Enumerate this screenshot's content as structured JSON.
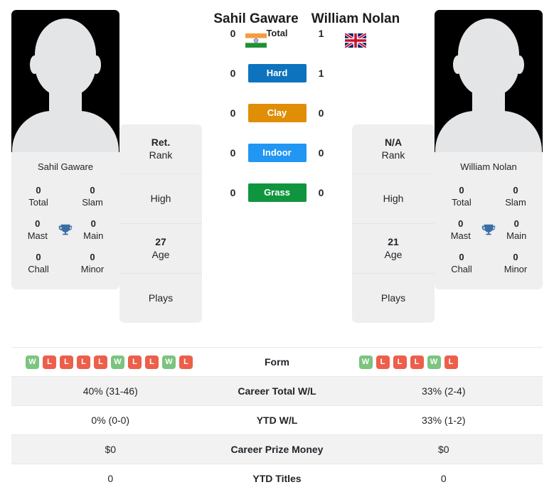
{
  "players": {
    "left": {
      "name": "Sahil Gaware",
      "photo_name": "Sahil Gaware",
      "country": "india",
      "rank_value": "Ret.",
      "rank_label": "Rank",
      "high_label": "High",
      "age_value": "27",
      "age_label": "Age",
      "plays_label": "Plays",
      "titles": [
        {
          "num": "0",
          "label": "Total"
        },
        {
          "num": "0",
          "label": "Slam"
        },
        {
          "num": "0",
          "label": "Mast"
        },
        {
          "num": "0",
          "label": "Main"
        },
        {
          "num": "0",
          "label": "Chall"
        },
        {
          "num": "0",
          "label": "Minor"
        }
      ],
      "form": [
        "W",
        "L",
        "L",
        "L",
        "L",
        "W",
        "L",
        "L",
        "W",
        "L"
      ]
    },
    "right": {
      "name": "William Nolan",
      "photo_name": "William Nolan",
      "country": "united-kingdom",
      "rank_value": "N/A",
      "rank_label": "Rank",
      "high_label": "High",
      "age_value": "21",
      "age_label": "Age",
      "plays_label": "Plays",
      "titles": [
        {
          "num": "0",
          "label": "Total"
        },
        {
          "num": "0",
          "label": "Slam"
        },
        {
          "num": "0",
          "label": "Mast"
        },
        {
          "num": "0",
          "label": "Main"
        },
        {
          "num": "0",
          "label": "Chall"
        },
        {
          "num": "0",
          "label": "Minor"
        }
      ],
      "form": [
        "W",
        "L",
        "L",
        "L",
        "W",
        "L"
      ]
    }
  },
  "head_to_head": [
    {
      "label": "Total",
      "left": "0",
      "right": "1",
      "color": "",
      "styled": false
    },
    {
      "label": "Hard",
      "left": "0",
      "right": "1",
      "color": "#0e73be",
      "styled": true
    },
    {
      "label": "Clay",
      "left": "0",
      "right": "0",
      "color": "#df8e06",
      "styled": true
    },
    {
      "label": "Indoor",
      "left": "0",
      "right": "0",
      "color": "#2196f3",
      "styled": true
    },
    {
      "label": "Grass",
      "left": "0",
      "right": "0",
      "color": "#10953f",
      "styled": true
    }
  ],
  "stats_rows": [
    {
      "label": "Form",
      "left": "",
      "right": "",
      "is_form": true,
      "shaded": false
    },
    {
      "label": "Career Total W/L",
      "left": "40% (31-46)",
      "right": "33% (2-4)",
      "is_form": false,
      "shaded": true
    },
    {
      "label": "YTD W/L",
      "left": "0% (0-0)",
      "right": "33% (1-2)",
      "is_form": false,
      "shaded": false
    },
    {
      "label": "Career Prize Money",
      "left": "$0",
      "right": "$0",
      "is_form": false,
      "shaded": true
    },
    {
      "label": "YTD Titles",
      "left": "0",
      "right": "0",
      "is_form": false,
      "shaded": false
    }
  ],
  "colors": {
    "win_badge": "#7cc47f",
    "loss_badge": "#ec5f4a",
    "trophy": "#3a6ea5",
    "card_bg": "#efefef",
    "row_shaded": "#f2f2f2"
  }
}
